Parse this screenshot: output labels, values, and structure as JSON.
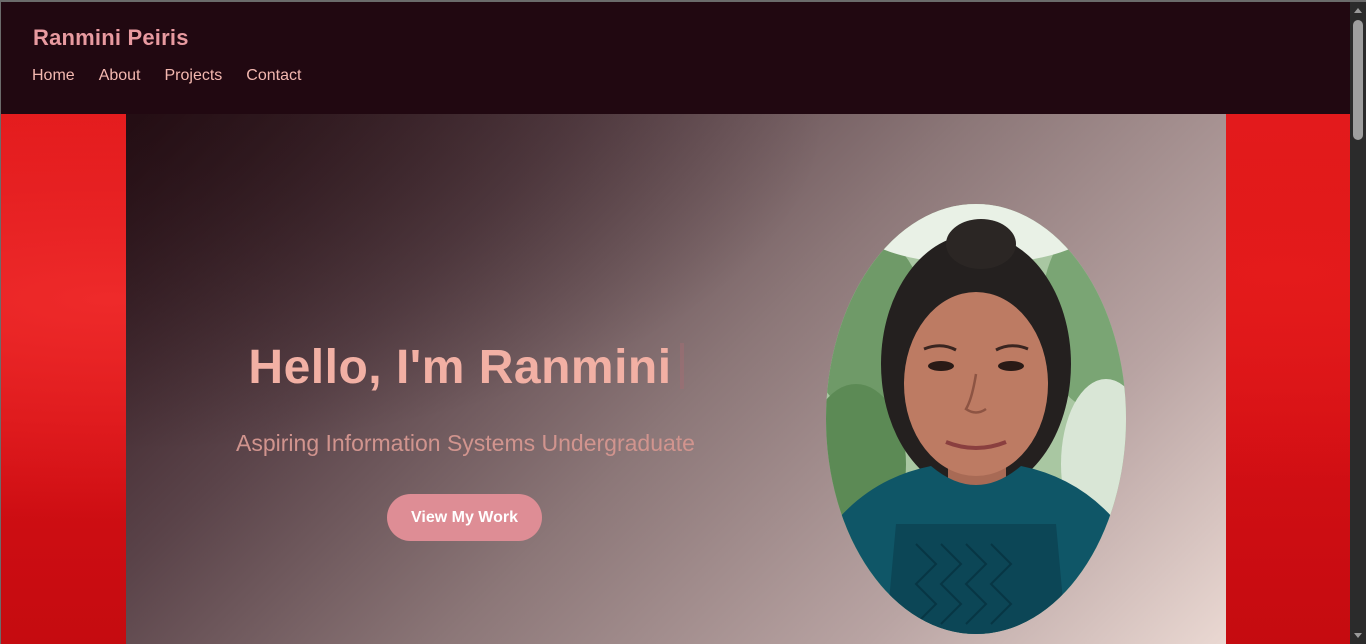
{
  "header": {
    "logo": "Ranmini Peiris",
    "nav": [
      "Home",
      "About",
      "Projects",
      "Contact"
    ]
  },
  "hero": {
    "headline": "Hello, I'm Ranmini",
    "subtitle": "Aspiring Information Systems Undergraduate",
    "cta_label": "View My Work"
  },
  "colors": {
    "header_bg": "#210811",
    "accent_pink": "#de8d95",
    "headline": "#f2b0a4",
    "backdrop_red": "#d30f14"
  }
}
